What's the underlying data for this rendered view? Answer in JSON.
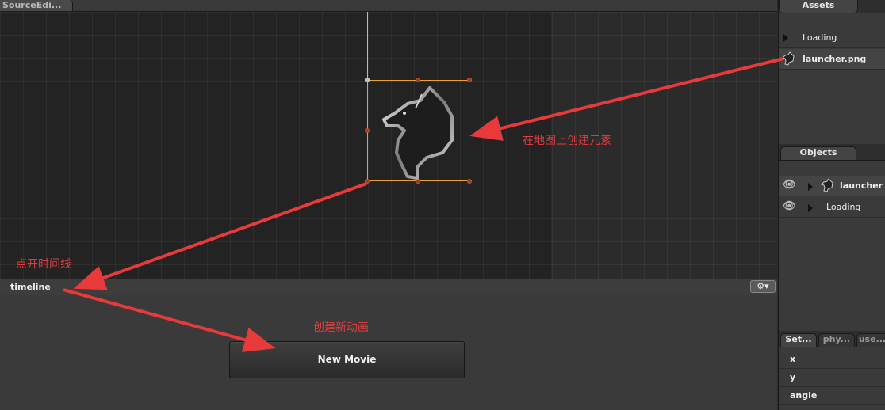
{
  "editor": {
    "tab_label": "SourceEdi..."
  },
  "timeline": {
    "label": "timeline",
    "gear_label": "⚙▾",
    "new_movie_label": "New Movie"
  },
  "assets": {
    "tab_label": "Assets",
    "items": [
      {
        "label": "Loading",
        "icon": "triangle-right-icon"
      },
      {
        "label": "launcher.png",
        "icon": "wolf-thumbnail-icon"
      }
    ]
  },
  "objects": {
    "tab_label": "Objects",
    "items": [
      {
        "label": "launcher",
        "icon": "wolf-thumbnail-icon",
        "visible_icon": "eye-icon"
      },
      {
        "label": "Loading",
        "icon": "triangle-right-icon",
        "visible_icon": "eye-icon"
      }
    ]
  },
  "properties": {
    "tabs": [
      {
        "label": "Set...",
        "active": true
      },
      {
        "label": "phy...",
        "active": false
      },
      {
        "label": "use...",
        "active": false
      }
    ],
    "rows": [
      {
        "label": "x"
      },
      {
        "label": "y"
      },
      {
        "label": "angle"
      }
    ]
  },
  "annotations": {
    "create_element": "在地图上创建元素",
    "open_timeline": "点开时间线",
    "create_animation": "创建新动画",
    "color": "#e23c3c"
  },
  "colors": {
    "selection": "#e8a33a",
    "axis": "#d9c23a",
    "arrow": "#e83a3a"
  }
}
